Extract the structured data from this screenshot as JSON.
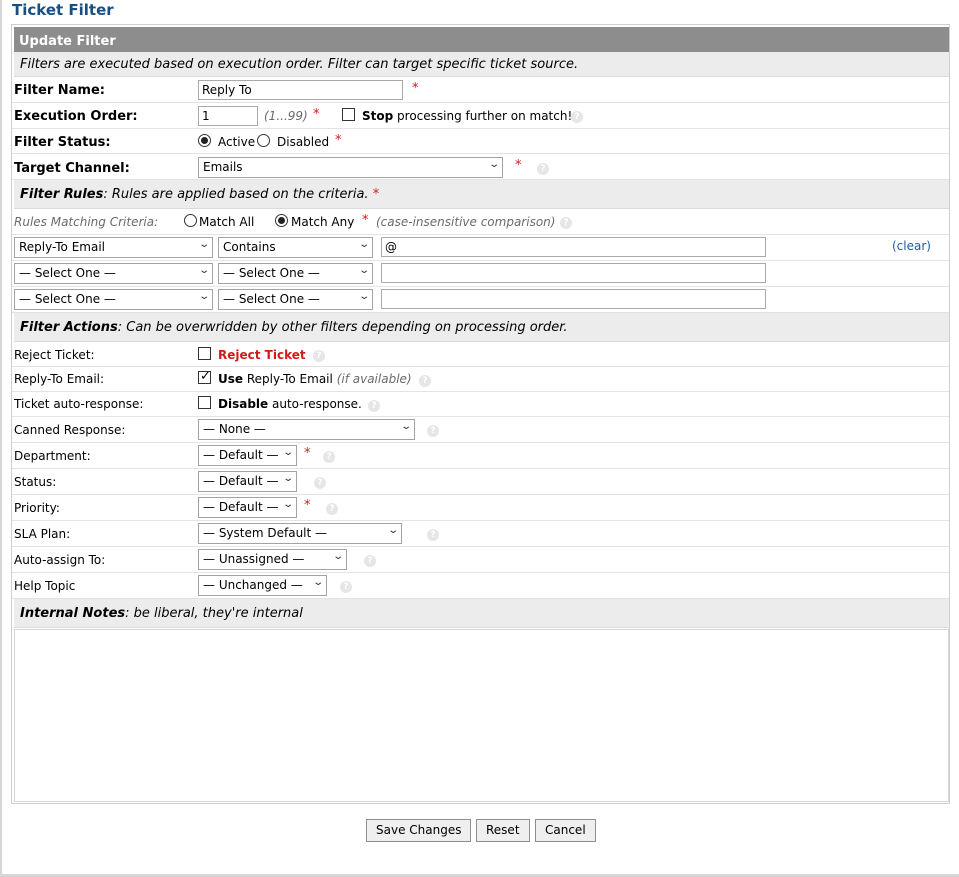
{
  "page_title": "Ticket Filter",
  "section_header": "Update Filter",
  "section_note": "Filters are executed based on execution order. Filter can target specific ticket source.",
  "filter_name": {
    "label": "Filter Name:",
    "value": "Reply To"
  },
  "execution_order": {
    "label": "Execution Order:",
    "value": "1",
    "range_hint": "(1...99)",
    "stop_bold": "Stop",
    "stop_rest": "processing further on match!"
  },
  "filter_status": {
    "label": "Filter Status:",
    "active": "Active",
    "disabled": "Disabled"
  },
  "target_channel": {
    "label": "Target Channel:",
    "value": "Emails"
  },
  "rules_header": {
    "title": "Filter Rules",
    "text": ": Rules are applied based on the criteria."
  },
  "criteria": {
    "label": "Rules Matching Criteria:",
    "match_all": "Match All",
    "match_any": "Match Any",
    "note": "(case-insensitive comparison)"
  },
  "rules": [
    {
      "field": "Reply-To Email",
      "operator": "Contains",
      "value": "@"
    },
    {
      "field": "— Select One —",
      "operator": "— Select One —",
      "value": ""
    },
    {
      "field": "— Select One —",
      "operator": "— Select One —",
      "value": ""
    }
  ],
  "clear_link": "(clear)",
  "actions_header": {
    "title": "Filter Actions",
    "text": ": Can be overwridden by other filters depending on processing order."
  },
  "actions": {
    "reject": {
      "label": "Reject Ticket:",
      "text": "Reject Ticket"
    },
    "reply_to": {
      "label": "Reply-To Email:",
      "bold": "Use",
      "text": "Reply-To Email",
      "hint": "(if available)"
    },
    "auto_response": {
      "label": "Ticket auto-response:",
      "bold": "Disable",
      "text": "auto-response."
    },
    "canned": {
      "label": "Canned Response:",
      "value": "— None —"
    },
    "department": {
      "label": "Department:",
      "value": "— Default —"
    },
    "status": {
      "label": "Status:",
      "value": "— Default —"
    },
    "priority": {
      "label": "Priority:",
      "value": "— Default —"
    },
    "sla": {
      "label": "SLA Plan:",
      "value": "— System Default —"
    },
    "assign": {
      "label": "Auto-assign To:",
      "value": "— Unassigned —"
    },
    "topic": {
      "label": "Help Topic",
      "value": "— Unchanged —"
    }
  },
  "notes_header": {
    "title": "Internal Notes",
    "text": ": be liberal, they're internal"
  },
  "notes_value": "",
  "buttons": {
    "save": "Save Changes",
    "reset": "Reset",
    "cancel": "Cancel"
  },
  "required_mark": "*",
  "help_glyph": "?"
}
